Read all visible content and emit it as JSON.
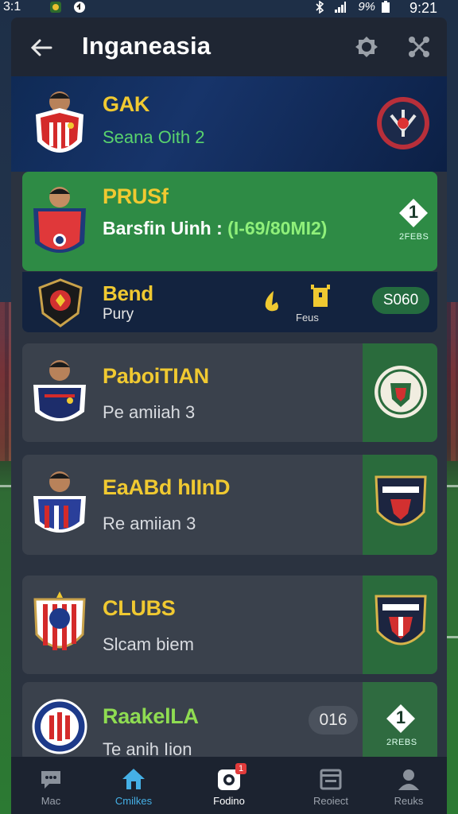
{
  "status_bar": {
    "time_left": "3:1",
    "battery_pct": "9%",
    "time_right": "9:21"
  },
  "header": {
    "title": "Inganeasia",
    "icons": [
      "back-arrow-icon",
      "settings-icon",
      "share-icon"
    ]
  },
  "list": {
    "items": [
      {
        "name": "GAK",
        "subtitle": "Seana Oith 2"
      },
      {
        "name": "PRUSf",
        "subtitle_prefix": "Barsfin Uinh : ",
        "subtitle_highlight": "(I-69/80MI2)",
        "badge_number": "1",
        "badge_caption": "2FEBS"
      },
      {
        "name": "Bend",
        "subtitle": "Pury",
        "mini_caption": "Feus",
        "pill": "S060"
      },
      {
        "name": "PaboiTIAN",
        "subtitle": "Pe amiiah 3"
      },
      {
        "name": "EaABd hIInD",
        "subtitle": "Re amiian 3"
      },
      {
        "name": "CLUBS",
        "subtitle": "Slcam biem"
      },
      {
        "name": "RaakelLA",
        "subtitle": "Te anih Iion",
        "score": "016",
        "badge_number": "1",
        "badge_caption": "2REBS"
      }
    ]
  },
  "bottom_nav": {
    "items": [
      {
        "label": "Mac",
        "icon": "chat-icon"
      },
      {
        "label": "Cmilkes",
        "icon": "home-icon"
      },
      {
        "label": "Fodino",
        "icon": "camera-icon",
        "notification": "1"
      },
      {
        "label": "Reoiect",
        "icon": "calendar-icon"
      },
      {
        "label": "Reuks",
        "icon": "profile-icon"
      }
    ]
  },
  "colors": {
    "accent_yellow": "#f0c931",
    "accent_green": "#2e8b45",
    "card_grey": "#3a414c",
    "nav_active": "#45b0e6"
  }
}
